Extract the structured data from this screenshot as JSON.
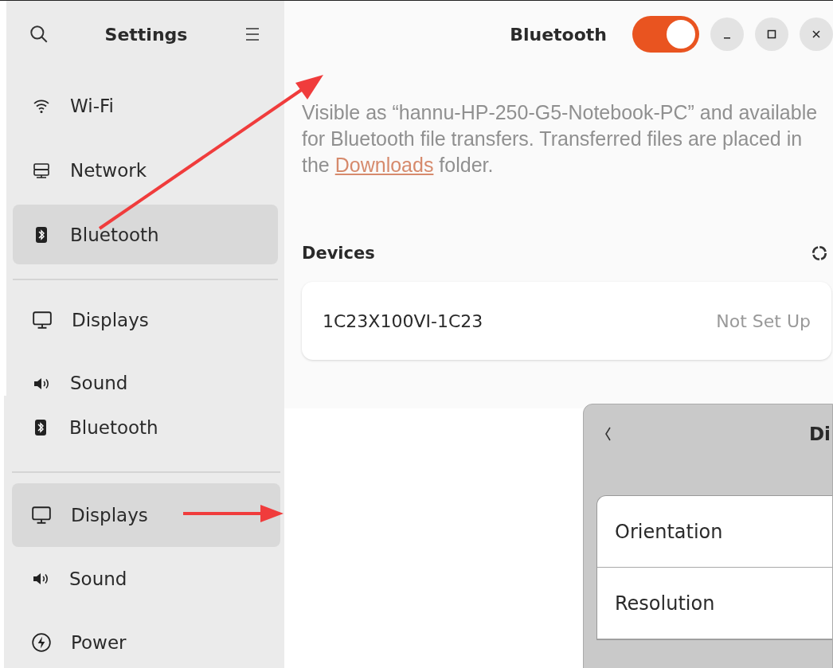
{
  "bluetooth_window": {
    "sidebar": {
      "title": "Settings",
      "items": [
        {
          "label": "Wi-Fi",
          "kind": "wifi",
          "selected": false,
          "group_start": false
        },
        {
          "label": "Network",
          "kind": "network",
          "selected": false,
          "group_start": false
        },
        {
          "label": "Bluetooth",
          "kind": "bluetooth",
          "selected": true,
          "group_start": false
        },
        {
          "label": "Displays",
          "kind": "display",
          "selected": false,
          "group_start": true
        },
        {
          "label": "Sound",
          "kind": "sound",
          "selected": false,
          "group_start": false
        }
      ]
    },
    "header": {
      "title": "Bluetooth",
      "toggle_on": true
    },
    "description": "Visible as “hannu-HP-250-G5-Notebook-PC” and available for Bluetooth file transfers. Transferred files are placed in the",
    "link": "Downloads",
    "description_end": "folder.",
    "devices_heading": "Devices",
    "devices": [
      {
        "name": "1C23X100VI-1C23",
        "status": "Not Set Up"
      }
    ]
  },
  "displays_sidebar": {
    "items": [
      {
        "label": "Bluetooth",
        "kind": "bluetooth",
        "selected": false,
        "group_start": false
      },
      {
        "label": "Displays",
        "kind": "display",
        "selected": true,
        "group_start": true
      },
      {
        "label": "Sound",
        "kind": "sound",
        "selected": false,
        "group_start": false
      },
      {
        "label": "Power",
        "kind": "power",
        "selected": false,
        "group_start": false
      }
    ]
  },
  "displays_window": {
    "title": "Di",
    "rows": [
      "Orientation",
      "Resolution"
    ]
  }
}
